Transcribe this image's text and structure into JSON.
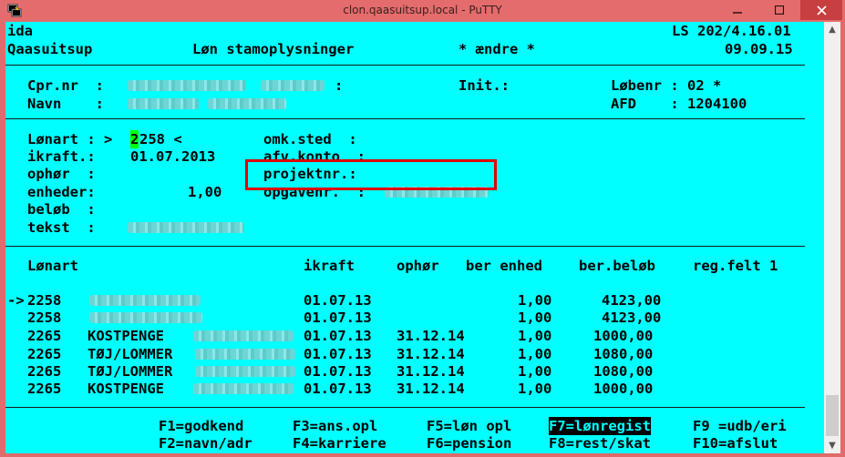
{
  "window": {
    "title": "clon.qaasuitsup.local - PuTTY"
  },
  "header": {
    "l1_left": "ida",
    "l1_right": "LS 202/4.16.01",
    "l2_left": "Qaasuitsup",
    "l2_mid": "Løn stamoplysninger",
    "l2_mode": "* ændre *",
    "l2_date": "09.09.15"
  },
  "person": {
    "cpr_label": "Cpr.nr  :",
    "cpr_sep": ":",
    "init_label": "Init.:",
    "lobenr_label": "Løbenr : 02 *",
    "navn_label": "Navn    :",
    "afd_label": "AFD    : 1204100"
  },
  "detail": {
    "lonart_label": "Lønart : >",
    "lonart_cursor": "2",
    "lonart_rest": "258 <",
    "ikraft_label": "ikraft.:",
    "ikraft_value": "01.07.2013",
    "ophor_label": "ophør  :",
    "enheder_label": "enheder:",
    "enheder_value": "1,00",
    "belob_label": "beløb  :",
    "tekst_label": "tekst  :",
    "omk_label": "omk.sted  :",
    "afv_label": "afv.konto  :",
    "projekt_label": "projektnr.:",
    "opgave_label": "opgavenr.  :"
  },
  "table": {
    "headers": {
      "lonart": "Lønart",
      "ikraft": "ikraft",
      "ophor": "ophør",
      "ber_enhed": "ber enhed",
      "ber_belob": "ber.beløb",
      "reg_felt": "reg.felt 1"
    },
    "rows": [
      {
        "marker": "->",
        "art": "2258",
        "text": "",
        "ikraft": "01.07.13",
        "ophor": "",
        "enhed": "1,00",
        "belob": "4123,00"
      },
      {
        "marker": "",
        "art": "2258",
        "text": "",
        "ikraft": "01.07.13",
        "ophor": "",
        "enhed": "1,00",
        "belob": "4123,00"
      },
      {
        "marker": "",
        "art": "2265",
        "text": "KOSTPENGE",
        "ikraft": "01.07.13",
        "ophor": "31.12.14",
        "enhed": "1,00",
        "belob": "1000,00"
      },
      {
        "marker": "",
        "art": "2265",
        "text": "TØJ/LOMMER",
        "ikraft": "01.07.13",
        "ophor": "31.12.14",
        "enhed": "1,00",
        "belob": "1080,00"
      },
      {
        "marker": "",
        "art": "2265",
        "text": "TØJ/LOMMER",
        "ikraft": "01.07.13",
        "ophor": "31.12.14",
        "enhed": "1,00",
        "belob": "1080,00"
      },
      {
        "marker": "",
        "art": "2265",
        "text": "KOSTPENGE",
        "ikraft": "01.07.13",
        "ophor": "31.12.14",
        "enhed": "1,00",
        "belob": "1000,00"
      }
    ]
  },
  "fkeys": {
    "f1": "F1=godkend",
    "f2": "F2=navn/adr",
    "f3": "F3=ans.opl",
    "f4": "F4=karriere",
    "f5": "F5=løn opl",
    "f6": "F6=pension",
    "f7": "F7=lønregist",
    "f8": "F8=rest/skat",
    "f9": "F9 =udb/eri",
    "f10": "F10=afslut"
  },
  "colors": {
    "terminal_bg": "#00ffff",
    "titlebar": "#e46c6c",
    "highlight_box": "#e00000",
    "cursor": "#00ff00"
  }
}
